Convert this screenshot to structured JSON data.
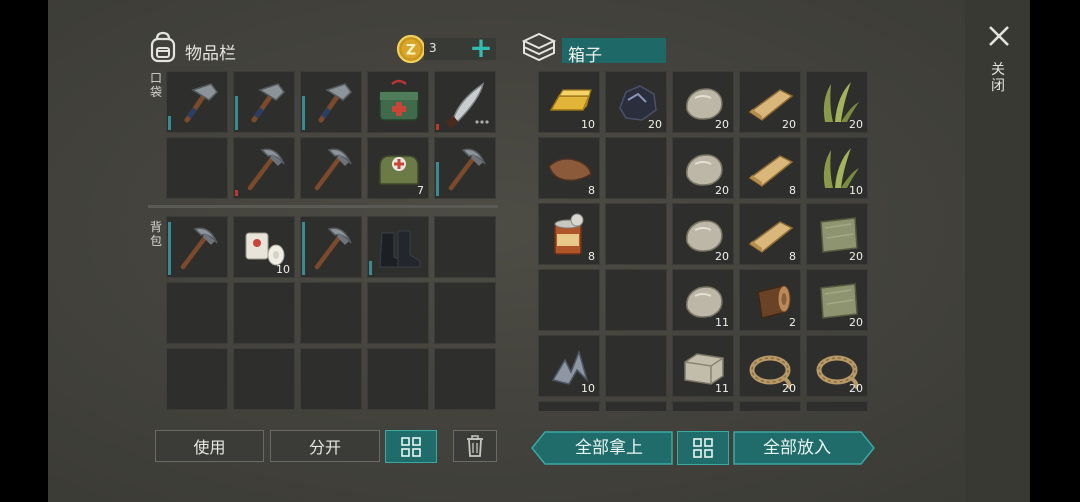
{
  "inventory": {
    "title": "物品栏",
    "coin_count": "3",
    "add_symbol": "+",
    "pocket_label": "口袋",
    "backpack_label": "背包",
    "pocket_slots": [
      {
        "icon": "hammer-icon",
        "qty": "",
        "durability": 0.25,
        "dur_color": "teal"
      },
      {
        "icon": "hammer-icon",
        "qty": "",
        "durability": 0.6,
        "dur_color": "teal"
      },
      {
        "icon": "hammer-icon",
        "qty": "",
        "durability": 0.6,
        "dur_color": "teal"
      },
      {
        "icon": "first-aid-kit-icon",
        "qty": "",
        "durability": 0,
        "dur_color": ""
      },
      {
        "icon": "machete-icon",
        "qty": "",
        "durability": 0.1,
        "dur_color": "red"
      },
      {
        "icon": "",
        "qty": "",
        "durability": 0,
        "dur_color": ""
      },
      {
        "icon": "pickaxe-icon",
        "qty": "",
        "durability": 0.1,
        "dur_color": "red"
      },
      {
        "icon": "pickaxe-icon",
        "qty": "",
        "durability": 0,
        "dur_color": ""
      },
      {
        "icon": "medical-bag-icon",
        "qty": "7",
        "durability": 0,
        "dur_color": ""
      },
      {
        "icon": "pickaxe-icon",
        "qty": "",
        "durability": 0.6,
        "dur_color": "teal"
      }
    ],
    "backpack_slots": [
      {
        "icon": "pickaxe-icon",
        "qty": "",
        "durability": 0.95,
        "dur_color": "teal"
      },
      {
        "icon": "bandage-icon",
        "qty": "10",
        "durability": 0,
        "dur_color": ""
      },
      {
        "icon": "pickaxe-icon",
        "qty": "",
        "durability": 0.95,
        "dur_color": "teal"
      },
      {
        "icon": "boots-icon",
        "qty": "",
        "durability": 0.25,
        "dur_color": "teal"
      },
      {
        "icon": "",
        "qty": "",
        "durability": 0,
        "dur_color": ""
      },
      {
        "icon": "",
        "qty": "",
        "durability": 0,
        "dur_color": ""
      },
      {
        "icon": "",
        "qty": "",
        "durability": 0,
        "dur_color": ""
      },
      {
        "icon": "",
        "qty": "",
        "durability": 0,
        "dur_color": ""
      },
      {
        "icon": "",
        "qty": "",
        "durability": 0,
        "dur_color": ""
      },
      {
        "icon": "",
        "qty": "",
        "durability": 0,
        "dur_color": ""
      },
      {
        "icon": "",
        "qty": "",
        "durability": 0,
        "dur_color": ""
      },
      {
        "icon": "",
        "qty": "",
        "durability": 0,
        "dur_color": ""
      },
      {
        "icon": "",
        "qty": "",
        "durability": 0,
        "dur_color": ""
      },
      {
        "icon": "",
        "qty": "",
        "durability": 0,
        "dur_color": ""
      },
      {
        "icon": "",
        "qty": "",
        "durability": 0,
        "dur_color": ""
      }
    ],
    "use_label": "使用",
    "split_label": "分开"
  },
  "chest": {
    "title": "箱子",
    "slots": [
      {
        "icon": "gold-bar-icon",
        "qty": "10"
      },
      {
        "icon": "coal-ore-icon",
        "qty": "20"
      },
      {
        "icon": "stone-icon",
        "qty": "20"
      },
      {
        "icon": "wood-plank-icon",
        "qty": "20"
      },
      {
        "icon": "plant-fiber-icon",
        "qty": "20"
      },
      {
        "icon": "leather-icon",
        "qty": "8"
      },
      {
        "icon": "",
        "qty": ""
      },
      {
        "icon": "stone-icon",
        "qty": "20"
      },
      {
        "icon": "wood-plank-icon",
        "qty": "8"
      },
      {
        "icon": "plant-fiber-icon",
        "qty": "10"
      },
      {
        "icon": "tin-can-icon",
        "qty": "8"
      },
      {
        "icon": "",
        "qty": ""
      },
      {
        "icon": "stone-icon",
        "qty": "20"
      },
      {
        "icon": "wood-plank-icon",
        "qty": "8"
      },
      {
        "icon": "cloth-icon",
        "qty": "20"
      },
      {
        "icon": "",
        "qty": ""
      },
      {
        "icon": "",
        "qty": ""
      },
      {
        "icon": "stone-icon",
        "qty": "11"
      },
      {
        "icon": "log-icon",
        "qty": "2"
      },
      {
        "icon": "cloth-icon",
        "qty": "20"
      },
      {
        "icon": "scrap-metal-icon",
        "qty": "10"
      },
      {
        "icon": "",
        "qty": ""
      },
      {
        "icon": "stone-block-icon",
        "qty": "11"
      },
      {
        "icon": "rope-icon",
        "qty": "20"
      },
      {
        "icon": "rope-icon",
        "qty": "20"
      }
    ],
    "take_all_label": "全部拿上",
    "put_all_label": "全部放入"
  },
  "close_label": "关闭",
  "colors": {
    "accent": "#1f6c6a",
    "accent_border": "#3aa9a3",
    "slot_bg": "#2e2f2c"
  }
}
